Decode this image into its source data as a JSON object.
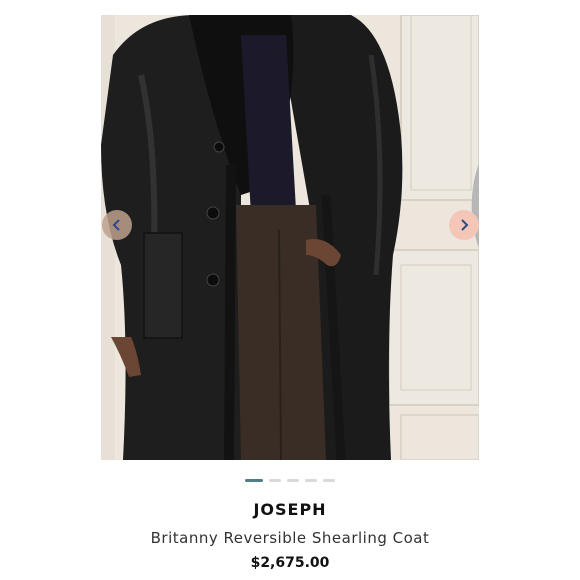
{
  "product": {
    "brand": "JOSEPH",
    "name": "Britanny Reversible Shearling Coat",
    "price": "$2,675.00"
  },
  "gallery": {
    "image_count": 5,
    "active_index": 0,
    "icons": {
      "zoom": "search-icon",
      "prev": "chevron-left-icon",
      "next": "chevron-right-icon"
    }
  },
  "colors": {
    "active_dot": "#4f7e87",
    "inactive_dot": "#d9d9d9",
    "next_arrow_bg": "#f3c6b8",
    "arrow_icon": "#2e4a8c"
  }
}
